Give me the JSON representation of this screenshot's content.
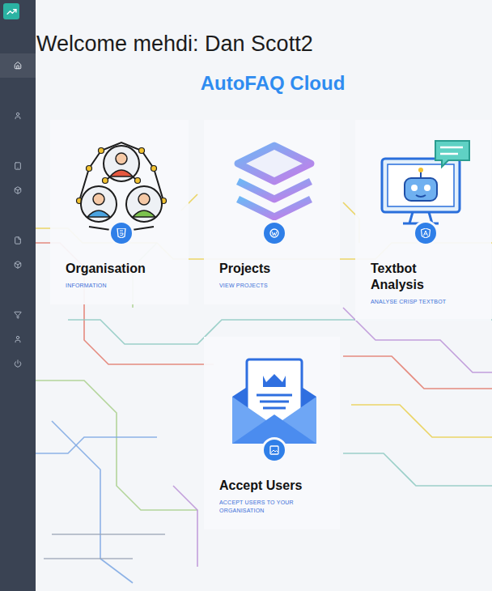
{
  "sidebar": {
    "items": [
      {
        "selected": true
      },
      {
        "selected": false
      },
      {
        "selected": false
      },
      {
        "selected": false
      },
      {
        "selected": false
      },
      {
        "selected": false
      },
      {
        "selected": false
      },
      {
        "selected": false
      },
      {
        "selected": false
      }
    ]
  },
  "welcome": "Welcome mehdi: Dan Scott2",
  "brand": "AutoFAQ Cloud",
  "cards": [
    {
      "title": "Organisation",
      "subtitle": "INFORMATION"
    },
    {
      "title": "Projects",
      "subtitle": "VIEW PROJECTS"
    },
    {
      "title": "Textbot Analysis",
      "subtitle": "ANALYSE CRISP TEXTBOT"
    },
    {
      "title": "Accept Users",
      "subtitle": "ACCEPT USERS TO YOUR ORGANISATION"
    }
  ]
}
